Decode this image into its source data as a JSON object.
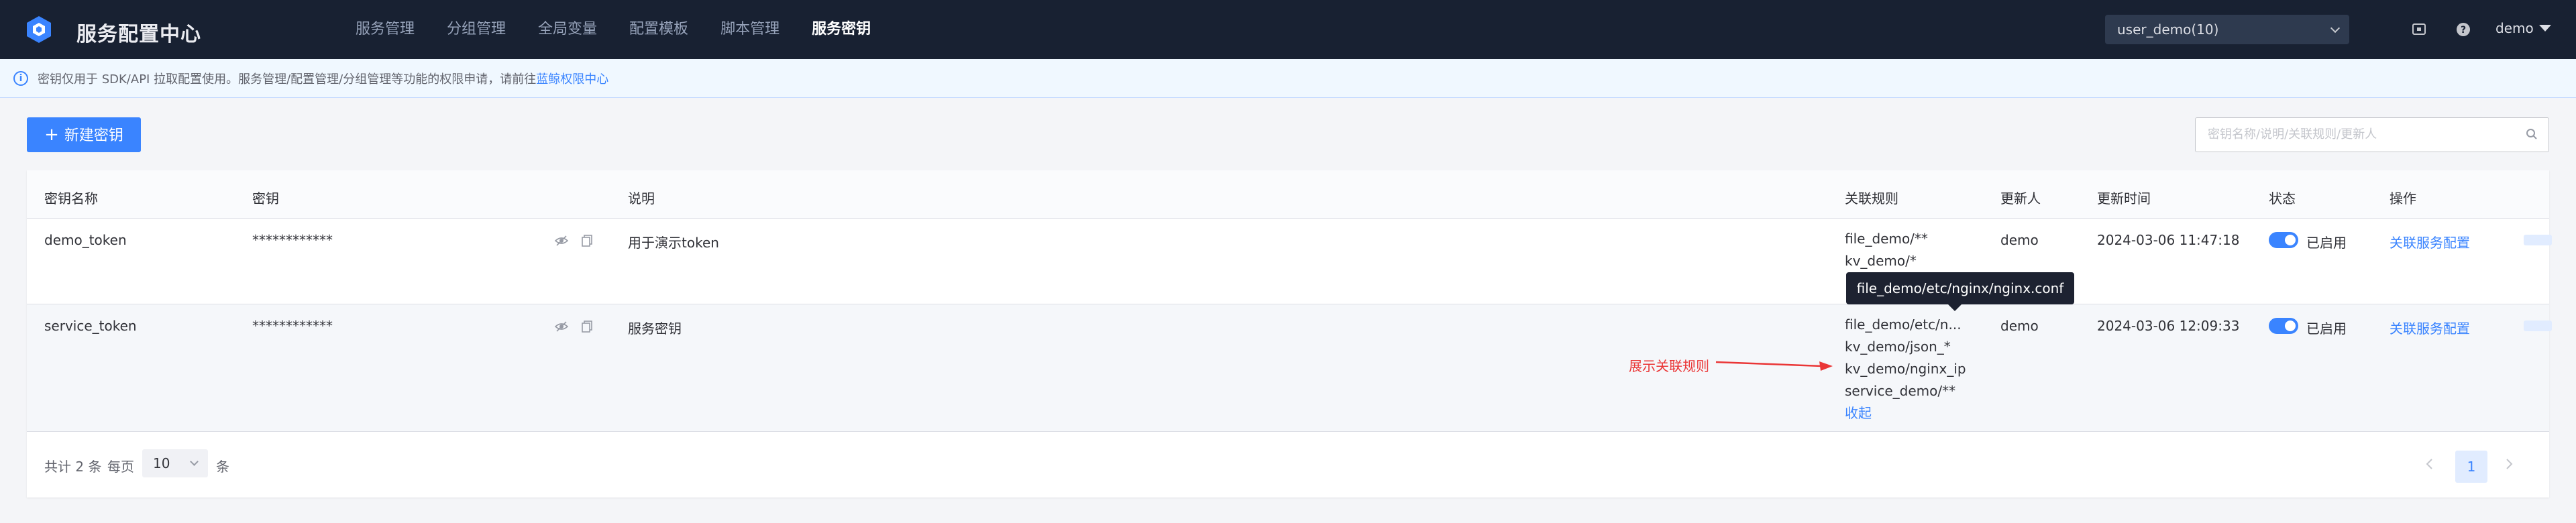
{
  "header": {
    "app_title": "服务配置中心",
    "nav": [
      {
        "label": "服务管理",
        "active": false
      },
      {
        "label": "分组管理",
        "active": false
      },
      {
        "label": "全局变量",
        "active": false
      },
      {
        "label": "配置模板",
        "active": false
      },
      {
        "label": "脚本管理",
        "active": false
      },
      {
        "label": "服务密钥",
        "active": true
      }
    ],
    "business_select": "user_demo(10)",
    "user": "demo",
    "icons": [
      "logo-icon",
      "screen-icon",
      "help-icon"
    ]
  },
  "notice": {
    "text": "密钥仅用于 SDK/API 拉取配置使用。服务管理/配置管理/分组管理等功能的权限申请，请前往",
    "link": "蓝鲸权限中心"
  },
  "toolbar": {
    "create_label": "新建密钥",
    "create_icon": "+",
    "search_placeholder": "密钥名称/说明/关联规则/更新人"
  },
  "table": {
    "columns": [
      "密钥名称",
      "密钥",
      "说明",
      "关联规则",
      "更新人",
      "更新时间",
      "状态",
      "操作"
    ],
    "rows": [
      {
        "name": "demo_token",
        "secret": "************",
        "desc": "用于演示token",
        "rules": [
          "file_demo/**",
          "kv_demo/*"
        ],
        "updater": "demo",
        "updated_at": "2024-03-06 11:47:18",
        "status": "已启用",
        "status_on": true,
        "op": "关联服务配置"
      },
      {
        "name": "service_token",
        "secret": "************",
        "desc": "服务密钥",
        "rules": [
          "file_demo/etc/n...",
          "kv_demo/json_*",
          "kv_demo/nginx_ip",
          "service_demo/**"
        ],
        "collapse_label": "收起",
        "updater": "demo",
        "updated_at": "2024-03-06 12:09:33",
        "status": "已启用",
        "status_on": true,
        "op": "关联服务配置"
      }
    ]
  },
  "tooltip": "file_demo/etc/nginx/nginx.conf",
  "annotation": "展示关联规则",
  "pagination": {
    "total": "共计 2 条",
    "per_page_label": "每页",
    "page_size": "10",
    "per_page_unit": "条",
    "current_page": "1"
  },
  "colors": {
    "topbar": "#182132",
    "primary": "#3a84ff",
    "annotation": "#ea3636"
  }
}
